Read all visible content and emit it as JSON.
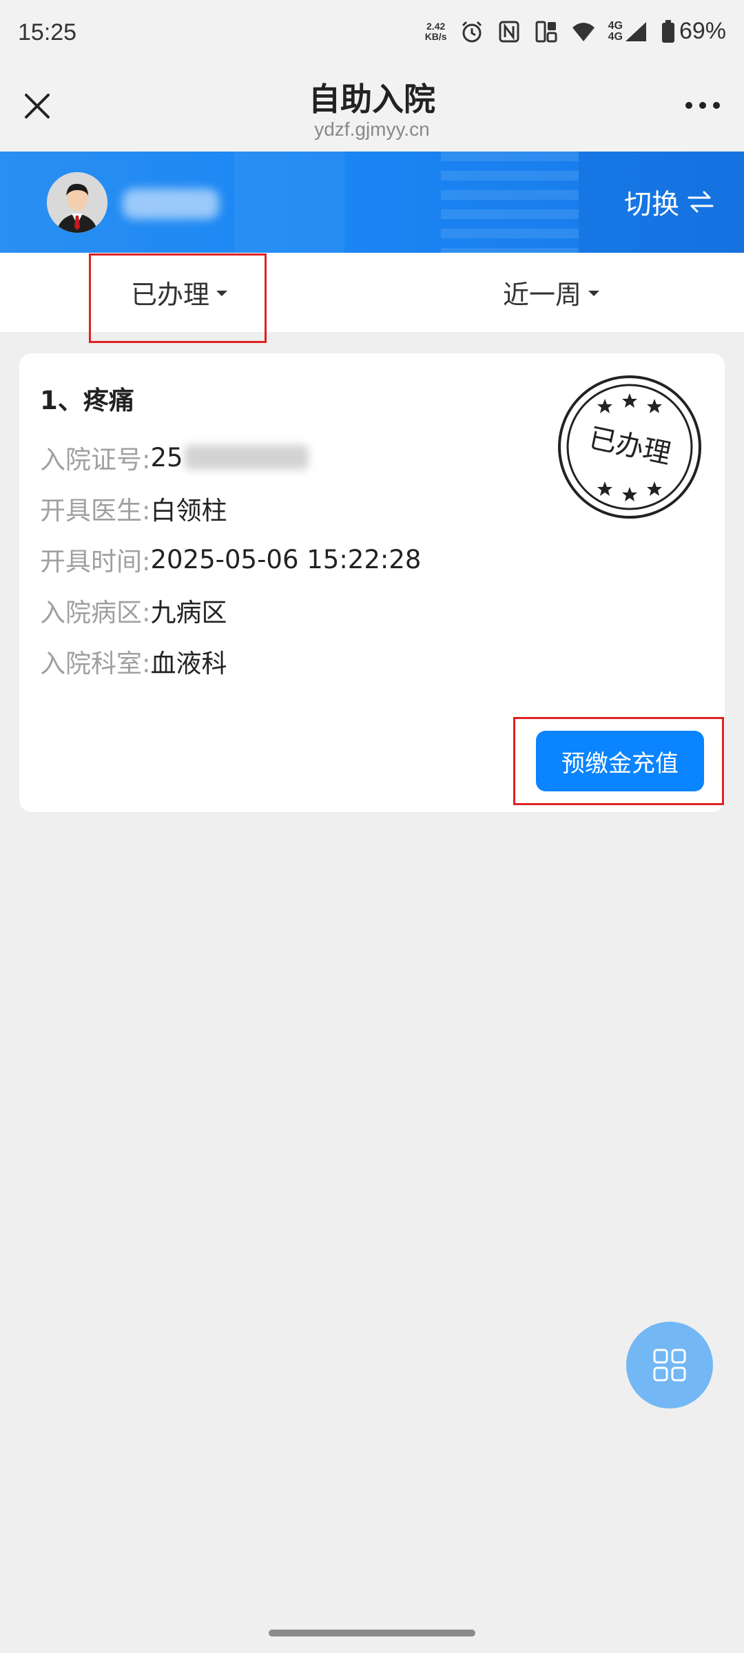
{
  "status_bar": {
    "time": "15:25",
    "net_speed_value": "2.42",
    "net_speed_unit": "KB/s",
    "signal_label_top": "4G",
    "signal_label_bottom": "4G",
    "battery": "69%"
  },
  "nav": {
    "title": "自助入院",
    "subtitle": "ydzf.gjmyy.cn"
  },
  "banner": {
    "switch_label": "切换"
  },
  "filters": {
    "status_label": "已办理",
    "period_label": "近一周"
  },
  "record": {
    "title": "1、疼痛",
    "stamp_text": "已办理",
    "fields": [
      {
        "label": "入院证号:",
        "value": "25"
      },
      {
        "label": "开具医生:",
        "value": "白领柱"
      },
      {
        "label": "开具时间:",
        "value": "2025-05-06 15:22:28"
      },
      {
        "label": "入院病区:",
        "value": "九病区"
      },
      {
        "label": "入院科室:",
        "value": "血液科"
      }
    ],
    "action_label": "预缴金充值"
  },
  "colors": {
    "primary": "#0a84ff",
    "banner": "#1b87f4",
    "highlight": "#e02020"
  }
}
